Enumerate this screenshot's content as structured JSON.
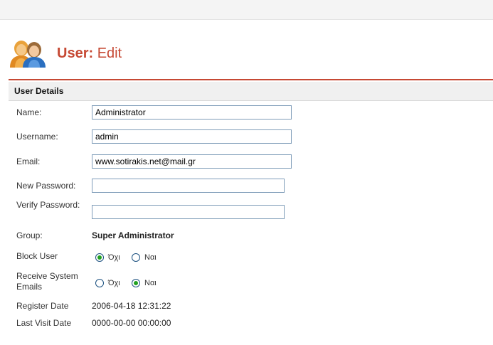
{
  "header": {
    "title_main": "User:",
    "title_sub": "Edit"
  },
  "section_title": "User Details",
  "fields": {
    "name": {
      "label": "Name:",
      "value": "Administrator"
    },
    "username": {
      "label": "Username:",
      "value": "admin"
    },
    "email": {
      "label": "Email:",
      "value": "www.sotirakis.net@mail.gr"
    },
    "new_password": {
      "label": "New Password:",
      "value": ""
    },
    "verify_password": {
      "label": "Verify Password:",
      "value": ""
    },
    "group": {
      "label": "Group:",
      "value": "Super Administrator"
    },
    "block_user": {
      "label": "Block User",
      "option_no": "Όχι",
      "option_yes": "Ναι",
      "selected": "no"
    },
    "receive_emails": {
      "label": "Receive System Emails",
      "option_no": "Όχι",
      "option_yes": "Ναι",
      "selected": "yes"
    },
    "register_date": {
      "label": "Register Date",
      "value": "2006-04-18 12:31:22"
    },
    "last_visit": {
      "label": "Last Visit Date",
      "value": "0000-00-00 00:00:00"
    }
  },
  "colors": {
    "accent": "#c64934",
    "radio_selected": "#21a121"
  },
  "icons": {
    "header": "users-icon"
  }
}
